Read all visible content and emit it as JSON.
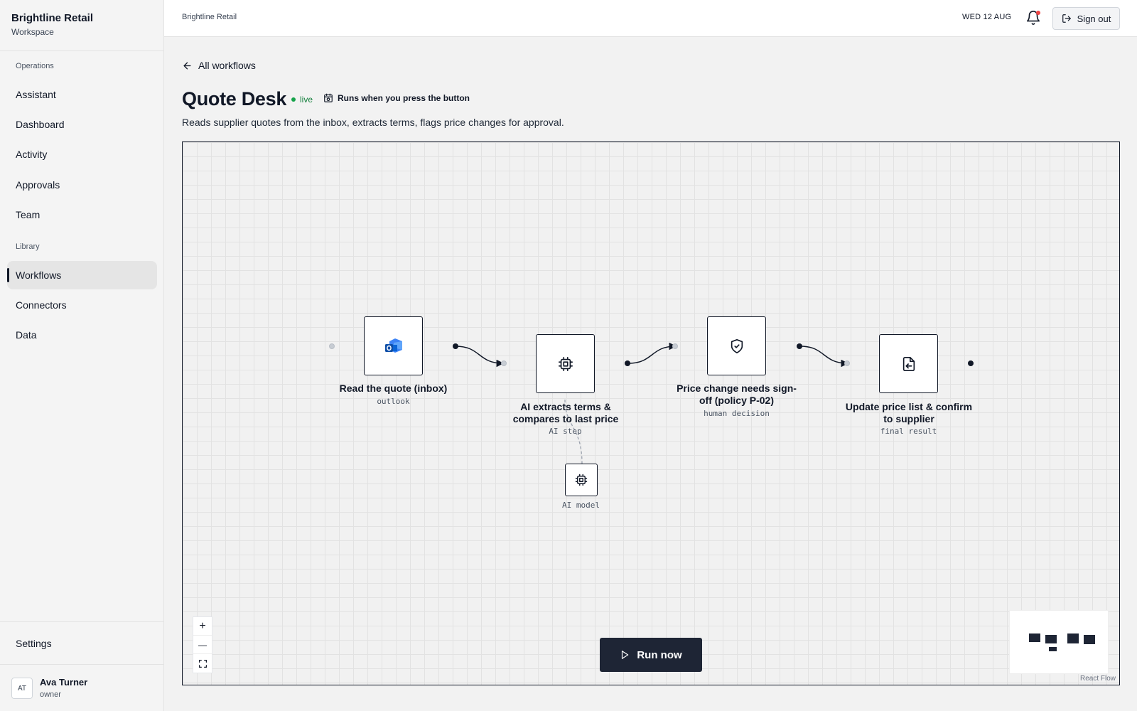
{
  "sidebar": {
    "brand_name": "Brightline Retail",
    "brand_sub": "Workspace",
    "sections": [
      {
        "label": "Operations",
        "items": [
          "Assistant",
          "Dashboard",
          "Activity",
          "Approvals",
          "Team"
        ]
      },
      {
        "label": "Library",
        "items": [
          "Workflows",
          "Connectors",
          "Data"
        ]
      }
    ],
    "active_item": "Workflows",
    "settings_label": "Settings",
    "user": {
      "initials": "AT",
      "name": "Ava Turner",
      "role": "owner"
    }
  },
  "topbar": {
    "breadcrumb": "Brightline Retail",
    "date": "WED 12 AUG",
    "has_notification": true,
    "signout_label": "Sign out"
  },
  "main": {
    "back_label": "All workflows",
    "title": "Quote Desk",
    "status": "live",
    "trigger_text": "Runs when you press the button",
    "description": "Reads supplier quotes from the inbox, extracts terms, flags price changes for approval."
  },
  "workflow": {
    "nodes": [
      {
        "label": "Read the quote (inbox)",
        "sub": "outlook",
        "icon": "outlook-icon"
      },
      {
        "label": "AI extracts terms & compares to last price",
        "sub": "AI step",
        "icon": "cpu-chip-icon"
      },
      {
        "label": "Price change needs sign-off (policy P-02)",
        "sub": "human decision",
        "icon": "shield-check-icon"
      },
      {
        "label": "Update price list & confirm to supplier",
        "sub": "final result",
        "icon": "file-export-icon"
      }
    ],
    "model_node": {
      "sub": "AI model",
      "icon": "cpu-chip-icon"
    },
    "run_label": "Run now",
    "controls": {
      "zoom_in": "+",
      "zoom_out": "—"
    },
    "attribution": "React Flow",
    "colors": {
      "ink": "#111827",
      "button": "#1e2535",
      "live": "#16a34a",
      "notify": "#ef4444"
    }
  }
}
